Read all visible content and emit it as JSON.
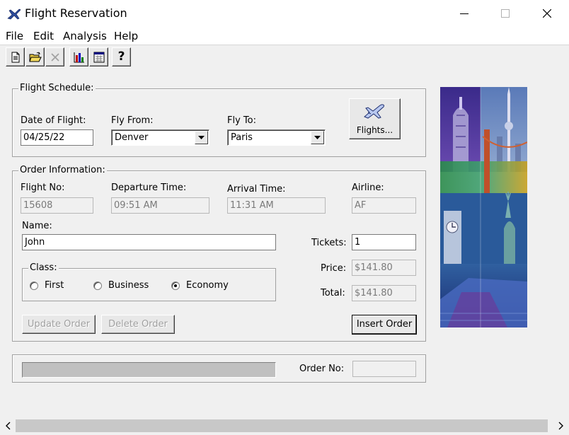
{
  "window": {
    "title": "Flight Reservation",
    "app_icon": "airplane-icon",
    "controls": [
      "minimize-icon",
      "maximize-icon",
      "close-icon"
    ]
  },
  "menu": [
    "File",
    "Edit",
    "Analysis",
    "Help"
  ],
  "toolbar": {
    "buttons": [
      "new-order-icon",
      "open-order-icon",
      "delete-order-icon",
      "graph-icon",
      "report-icon",
      "help-icon"
    ],
    "help_label": "?"
  },
  "flight_schedule": {
    "legend": "Flight Schedule:",
    "date_label": "Date of Flight:",
    "date_value": "04/25/22",
    "from_label": "Fly From:",
    "from_value": "Denver",
    "to_label": "Fly To:",
    "to_value": "Paris",
    "flights_button": "Flights..."
  },
  "order_info": {
    "legend": "Order Information:",
    "flight_no_label": "Flight No:",
    "flight_no_value": "15608",
    "departure_label": "Departure Time:",
    "departure_value": "09:51 AM",
    "arrival_label": "Arrival Time:",
    "arrival_value": "11:31 AM",
    "airline_label": "Airline:",
    "airline_value": "AF",
    "name_label": "Name:",
    "name_value": "John",
    "tickets_label": "Tickets:",
    "tickets_value": "1",
    "price_label": "Price:",
    "price_value": "$141.80",
    "total_label": "Total:",
    "total_value": "$141.80",
    "class_legend": "Class:",
    "class_options": [
      "First",
      "Business",
      "Economy"
    ],
    "class_selected": "Economy",
    "update_button": "Update Order",
    "delete_button": "Delete Order",
    "insert_button": "Insert Order"
  },
  "status": {
    "order_no_label": "Order No:",
    "order_no_value": ""
  },
  "colors": {
    "window_bg": "#f0f0f0",
    "title_bg": "#ffffff",
    "disabled_text": "#a0a0a0",
    "progress_fill": "#c0c0c0"
  }
}
